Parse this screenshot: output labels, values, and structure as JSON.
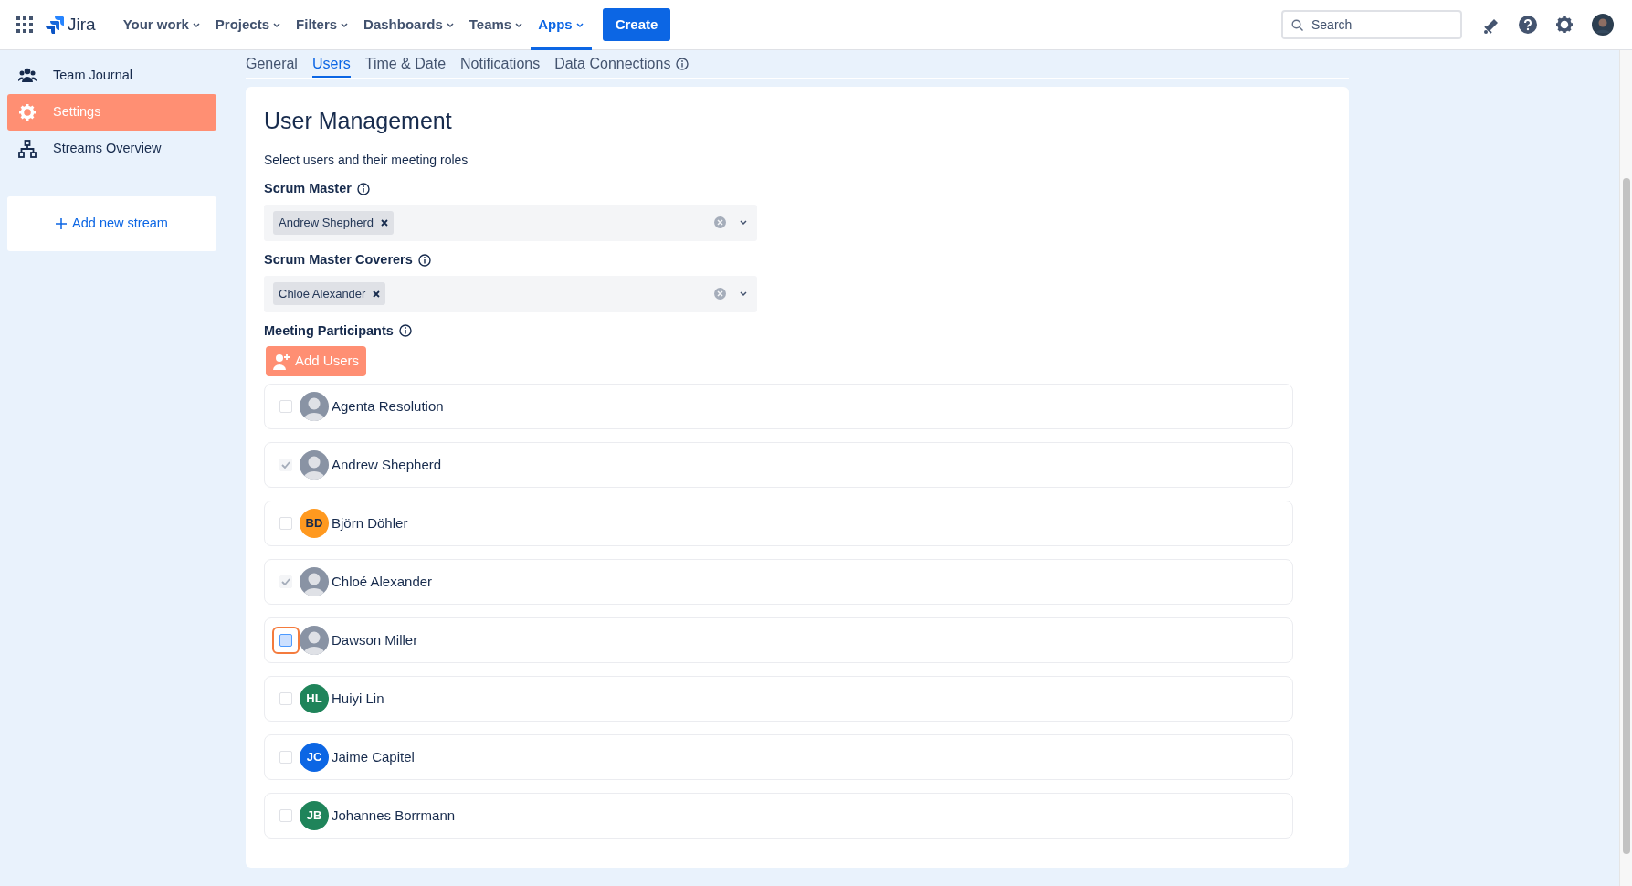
{
  "topbar": {
    "product": "Jira",
    "nav": [
      {
        "label": "Your work",
        "selected": false
      },
      {
        "label": "Projects",
        "selected": false
      },
      {
        "label": "Filters",
        "selected": false
      },
      {
        "label": "Dashboards",
        "selected": false
      },
      {
        "label": "Teams",
        "selected": false
      },
      {
        "label": "Apps",
        "selected": true
      }
    ],
    "create": "Create",
    "search": {
      "placeholder": "Search"
    }
  },
  "sidebar": {
    "items": [
      {
        "label": "Team Journal",
        "selected": false
      },
      {
        "label": "Settings",
        "selected": true
      },
      {
        "label": "Streams Overview",
        "selected": false
      }
    ],
    "add": "Add new stream"
  },
  "tabs": [
    {
      "label": "General",
      "selected": false
    },
    {
      "label": "Users",
      "selected": true
    },
    {
      "label": "Time & Date",
      "selected": false
    },
    {
      "label": "Notifications",
      "selected": false
    },
    {
      "label": "Data Connections",
      "selected": false,
      "info": true
    }
  ],
  "panel": {
    "title": "User Management",
    "description": "Select users and their meeting roles",
    "fields": [
      {
        "label": "Scrum Master",
        "tags": [
          "Andrew Shepherd"
        ]
      },
      {
        "label": "Scrum Master Coverers",
        "tags": [
          "Chloé Alexander"
        ]
      }
    ],
    "participants_label": "Meeting Participants",
    "add_users": "Add Users",
    "participants": [
      {
        "name": "Agenta Resolution",
        "kind": "photo",
        "checked": false,
        "focused": false
      },
      {
        "name": "Andrew Shepherd",
        "kind": "photo",
        "checked": true,
        "focused": false
      },
      {
        "name": "Björn Döhler",
        "kind": "initials",
        "initials": "BD",
        "color": "#ff991f",
        "checked": false,
        "focused": false
      },
      {
        "name": "Chloé Alexander",
        "kind": "photo",
        "checked": true,
        "focused": false
      },
      {
        "name": "Dawson Miller",
        "kind": "photo",
        "checked": false,
        "focused": true
      },
      {
        "name": "Huiyi Lin",
        "kind": "initials",
        "initials": "HL",
        "color": "#1f845a",
        "checked": false,
        "focused": false
      },
      {
        "name": "Jaime Capitel",
        "kind": "initials",
        "initials": "JC",
        "color": "#0c66e4",
        "checked": false,
        "focused": false
      },
      {
        "name": "Johannes Borrmann",
        "kind": "initials",
        "initials": "JB",
        "color": "#1f845a",
        "checked": false,
        "focused": false
      }
    ]
  }
}
